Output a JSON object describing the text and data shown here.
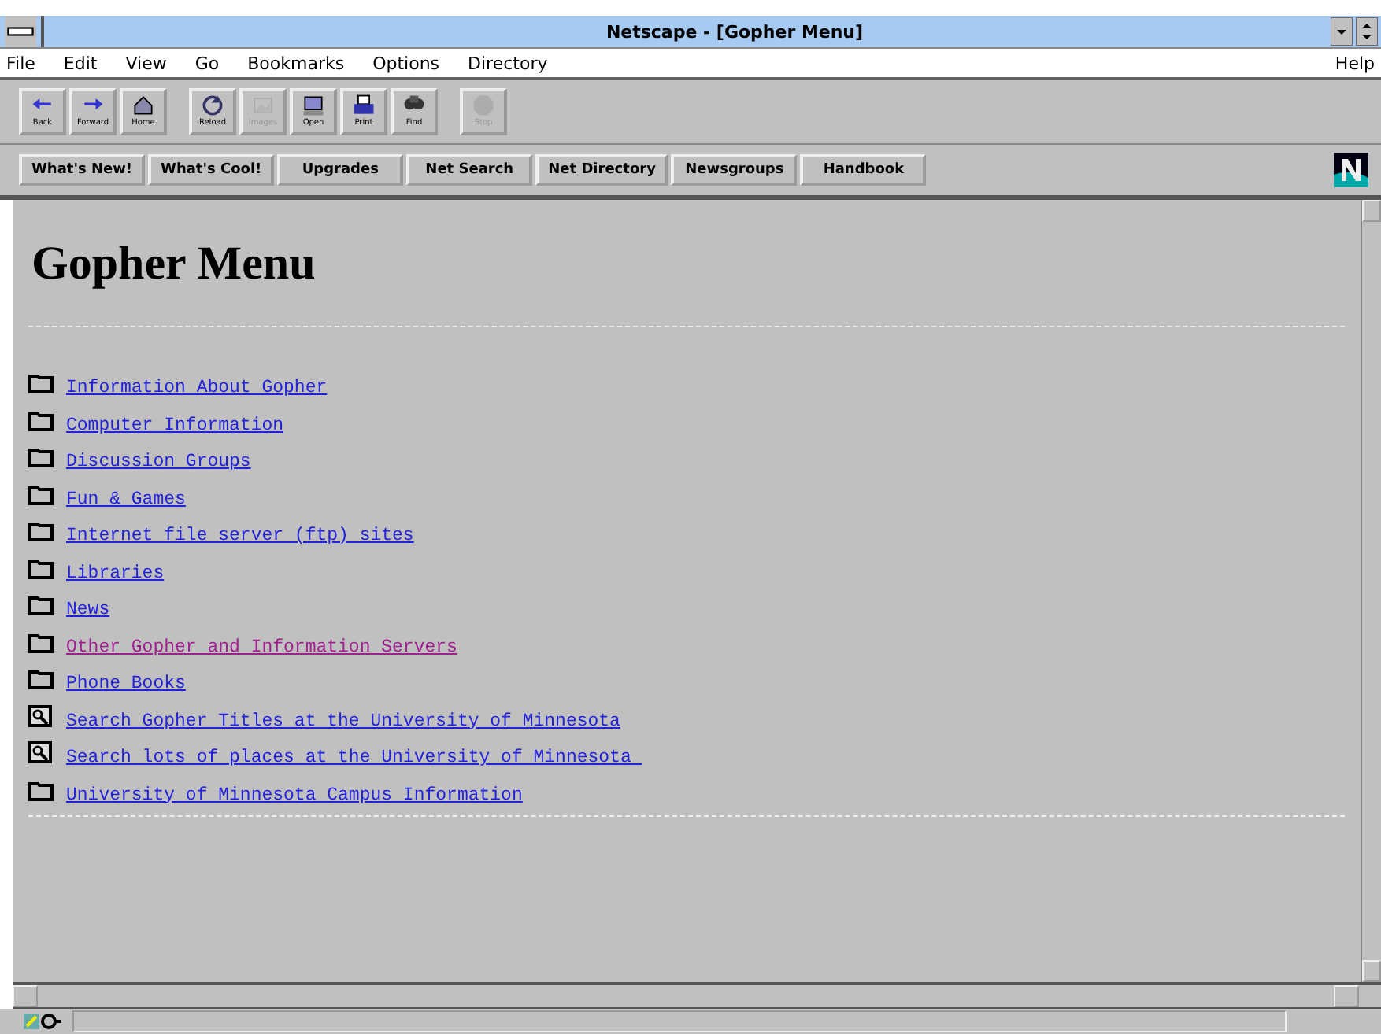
{
  "window": {
    "title": "Netscape - [Gopher Menu]"
  },
  "menu": [
    "File",
    "Edit",
    "View",
    "Go",
    "Bookmarks",
    "Options",
    "Directory"
  ],
  "help_menu": "Help",
  "toolbar": [
    [
      {
        "label": "Back",
        "disabled": false
      },
      {
        "label": "Forward",
        "disabled": false
      },
      {
        "label": "Home",
        "disabled": false
      }
    ],
    [
      {
        "label": "Reload",
        "disabled": false
      },
      {
        "label": "Images",
        "disabled": true
      },
      {
        "label": "Open",
        "disabled": false
      },
      {
        "label": "Print",
        "disabled": false
      },
      {
        "label": "Find",
        "disabled": false
      }
    ],
    [
      {
        "label": "Stop",
        "disabled": true
      }
    ]
  ],
  "directory_buttons": [
    "What's New!",
    "What's Cool!",
    "Upgrades",
    "Net Search",
    "Net Directory",
    "Newsgroups",
    "Handbook"
  ],
  "page": {
    "heading": "Gopher Menu",
    "items": [
      {
        "kind": "folder",
        "label": "Information About Gopher",
        "visited": false
      },
      {
        "kind": "folder",
        "label": "Computer Information",
        "visited": false
      },
      {
        "kind": "folder",
        "label": "Discussion Groups",
        "visited": false
      },
      {
        "kind": "folder",
        "label": "Fun & Games",
        "visited": false
      },
      {
        "kind": "folder",
        "label": "Internet file server (ftp) sites",
        "visited": false
      },
      {
        "kind": "folder",
        "label": "Libraries",
        "visited": false
      },
      {
        "kind": "folder",
        "label": "News",
        "visited": false
      },
      {
        "kind": "folder",
        "label": "Other Gopher and Information Servers",
        "visited": true
      },
      {
        "kind": "folder",
        "label": "Phone Books",
        "visited": false
      },
      {
        "kind": "search",
        "label": "Search Gopher Titles at the University of Minnesota",
        "visited": false
      },
      {
        "kind": "search",
        "label": "Search lots of places at the University of Minnesota ",
        "visited": false
      },
      {
        "kind": "folder",
        "label": "University of Minnesota Campus Information",
        "visited": false
      }
    ]
  }
}
